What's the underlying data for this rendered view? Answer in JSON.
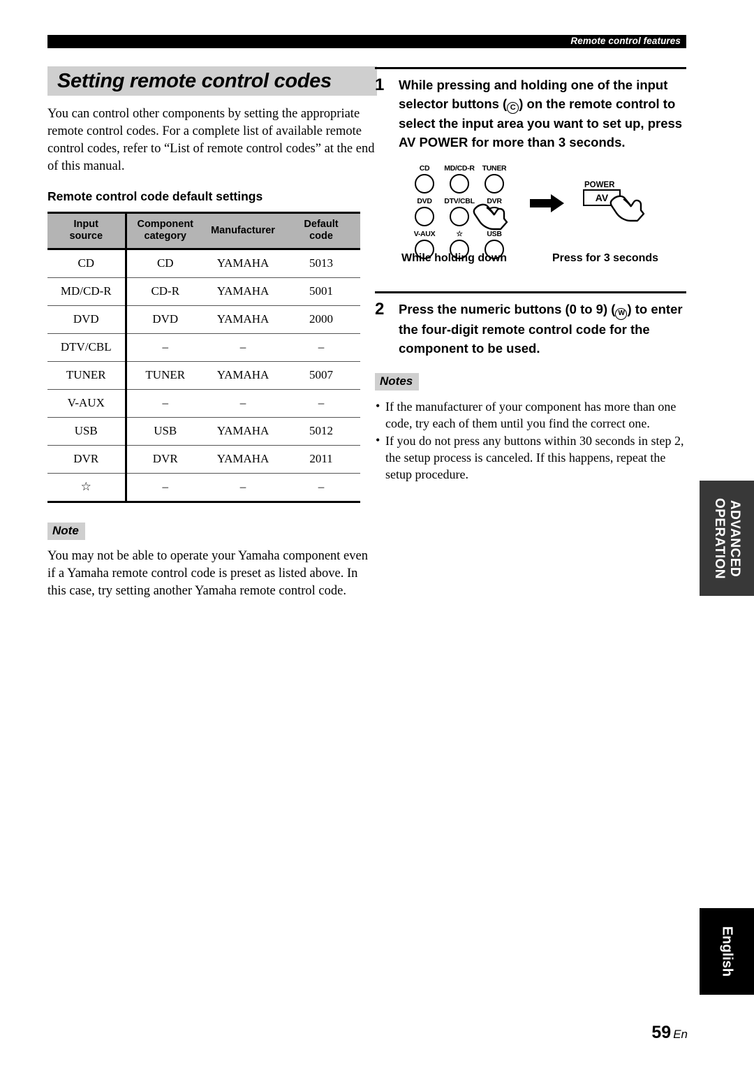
{
  "running_head": "Remote control features",
  "section": {
    "title": "Setting remote control codes",
    "intro": "You can control other components by setting the appropriate remote control codes. For a complete list of available remote control codes, refer to “List of remote control codes” at the end of this manual.",
    "sub_heading": "Remote control code default settings"
  },
  "table": {
    "headers": [
      "Input source",
      "Component category",
      "Manufacturer",
      "Default code"
    ],
    "header_lines": [
      [
        "Input",
        "source"
      ],
      [
        "Component",
        "category"
      ],
      [
        "Manufacturer",
        ""
      ],
      [
        "Default",
        "code"
      ]
    ],
    "rows": [
      {
        "input_source": "CD",
        "component_category": "CD",
        "manufacturer": "YAMAHA",
        "default_code": "5013"
      },
      {
        "input_source": "MD/CD-R",
        "component_category": "CD-R",
        "manufacturer": "YAMAHA",
        "default_code": "5001"
      },
      {
        "input_source": "DVD",
        "component_category": "DVD",
        "manufacturer": "YAMAHA",
        "default_code": "2000"
      },
      {
        "input_source": "DTV/CBL",
        "component_category": "–",
        "manufacturer": "–",
        "default_code": "–"
      },
      {
        "input_source": "TUNER",
        "component_category": "TUNER",
        "manufacturer": "YAMAHA",
        "default_code": "5007"
      },
      {
        "input_source": "V-AUX",
        "component_category": "–",
        "manufacturer": "–",
        "default_code": "–"
      },
      {
        "input_source": "USB",
        "component_category": "USB",
        "manufacturer": "YAMAHA",
        "default_code": "5012"
      },
      {
        "input_source": "DVR",
        "component_category": "DVR",
        "manufacturer": "YAMAHA",
        "default_code": "2011"
      },
      {
        "input_source": "☆",
        "component_category": "–",
        "manufacturer": "–",
        "default_code": "–"
      }
    ]
  },
  "note_left": {
    "tag": "Note",
    "body": "You may not be able to operate your Yamaha component even if a Yamaha remote control code is preset as listed above. In this case, try setting another Yamaha remote control code."
  },
  "steps": [
    {
      "number": "1",
      "text_part1": "While pressing and holding one of the input selector buttons (",
      "symbol": "C",
      "text_part2": ") on the remote control to select the input area you want to set up, press ",
      "emphasis": "AV POWER",
      "text_part3": " for more than 3 seconds."
    },
    {
      "number": "2",
      "text_part1": "Press the numeric buttons (0 to 9) (",
      "symbol": "W",
      "text_part2": ") to enter the four-digit remote control code for the component to be used.",
      "emphasis": "",
      "text_part3": ""
    }
  ],
  "diagram": {
    "buttons": [
      [
        "CD",
        "MD/CD-R",
        "TUNER"
      ],
      [
        "DVD",
        "DTV/CBL",
        "DVR"
      ],
      [
        "V-AUX",
        "☆",
        "USB"
      ]
    ],
    "power_label": "POWER",
    "av_label": "AV",
    "caption_left": "While holding down",
    "caption_right": "Press for 3 seconds"
  },
  "notes_right": {
    "tag": "Notes",
    "bullet": "•",
    "items": [
      "If the manufacturer of your component has more than one code, try each of them until you find the correct one.",
      "If you do not press any buttons within 30 seconds in step 2, the setup process is canceled. If this happens, repeat the setup procedure."
    ]
  },
  "side_tabs": {
    "advanced_line1": "ADVANCED",
    "advanced_line2": "OPERATION",
    "language": "English"
  },
  "folio": {
    "page_number": "59",
    "language_code": "En"
  },
  "colors": {
    "runhead_bar": "#000000",
    "title_band": "#cfcfcf",
    "table_header": "#b4b4b4",
    "tab_advanced": "#383838",
    "tab_english": "#000000"
  }
}
